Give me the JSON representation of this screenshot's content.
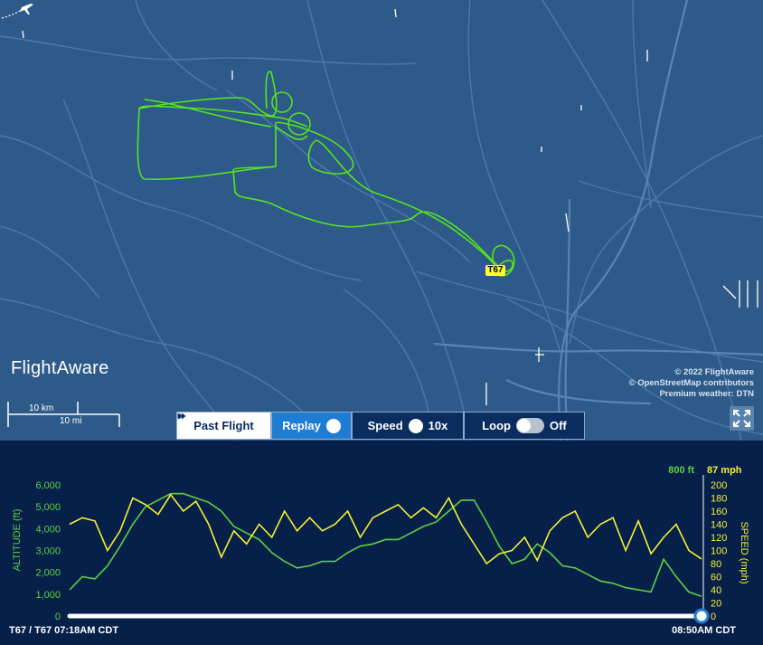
{
  "map": {
    "colors": {
      "water_bg": "#2e5a8a",
      "road": "#4a7aaa",
      "track": "#55e31f",
      "label_bg": "#ffff33"
    },
    "aircraft_label": "T67",
    "logo_text": "FlightAware",
    "scale": {
      "km_label": "10 km",
      "mi_label": "10 mi"
    },
    "attribution": [
      "© 2022 FlightAware",
      "© OpenStreetMap contributors",
      "Premium weather: DTN"
    ]
  },
  "controls": {
    "past_flight": "Past Flight",
    "replay": "Replay",
    "speed_label": "Speed",
    "speed_value": "10x",
    "loop_label": "Loop",
    "loop_state": "Off",
    "loop_on": false
  },
  "chart_data": {
    "type": "line",
    "colors": {
      "altitude": "#5fd13f",
      "speed": "#f4f032"
    },
    "altitude_axis": {
      "label": "ALTITUDE (ft)",
      "ticks": [
        "6,000",
        "5,000",
        "4,000",
        "3,000",
        "2,000",
        "1,000",
        "0"
      ],
      "ylim": [
        0,
        6000
      ],
      "current": "800 ft"
    },
    "speed_axis": {
      "label": "SPEED (mph)",
      "ticks": [
        "200",
        "180",
        "160",
        "140",
        "120",
        "100",
        "80",
        "60",
        "40",
        "20",
        "0"
      ],
      "ylim": [
        0,
        200
      ],
      "current": "87 mph"
    },
    "progress": 1.0,
    "start_label": "T67 / T67 07:18AM CDT",
    "end_label": "08:50AM CDT",
    "x": [
      0,
      0.02,
      0.04,
      0.06,
      0.08,
      0.1,
      0.12,
      0.14,
      0.16,
      0.18,
      0.2,
      0.22,
      0.24,
      0.26,
      0.28,
      0.3,
      0.32,
      0.34,
      0.36,
      0.38,
      0.4,
      0.42,
      0.44,
      0.46,
      0.48,
      0.5,
      0.52,
      0.54,
      0.56,
      0.58,
      0.6,
      0.62,
      0.64,
      0.66,
      0.68,
      0.7,
      0.72,
      0.74,
      0.76,
      0.78,
      0.8,
      0.82,
      0.84,
      0.86,
      0.88,
      0.9,
      0.92,
      0.94,
      0.96,
      0.98,
      1.0
    ],
    "series": [
      {
        "name": "ALTITUDE (ft)",
        "axis": "altitude",
        "values": [
          1200,
          1800,
          1700,
          2300,
          3200,
          4200,
          5000,
          5300,
          5600,
          5600,
          5400,
          5200,
          4800,
          4100,
          3800,
          3500,
          2900,
          2500,
          2200,
          2300,
          2500,
          2500,
          2900,
          3200,
          3300,
          3500,
          3500,
          3800,
          4100,
          4300,
          4800,
          5300,
          5300,
          4300,
          3200,
          2400,
          2600,
          3300,
          2900,
          2300,
          2200,
          1900,
          1600,
          1500,
          1300,
          1200,
          1100,
          2600,
          1800,
          1100,
          900
        ]
      },
      {
        "name": "SPEED (mph)",
        "axis": "speed",
        "values": [
          140,
          150,
          145,
          100,
          130,
          180,
          170,
          155,
          185,
          160,
          175,
          140,
          90,
          130,
          110,
          140,
          120,
          160,
          130,
          150,
          130,
          140,
          160,
          120,
          150,
          160,
          170,
          150,
          165,
          150,
          180,
          140,
          110,
          80,
          95,
          100,
          120,
          85,
          130,
          150,
          160,
          120,
          140,
          150,
          100,
          145,
          95,
          120,
          140,
          100,
          87
        ]
      }
    ]
  }
}
